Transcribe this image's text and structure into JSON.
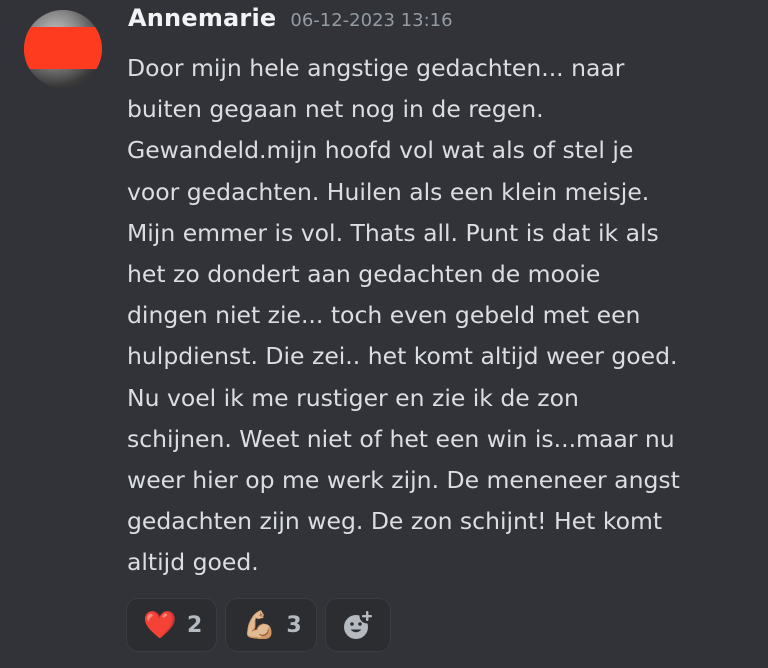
{
  "message": {
    "username": "Annemarie",
    "timestamp": "06-12-2023 13:16",
    "lines": [
      "Door mijn hele angstige gedachten... naar",
      "buiten gegaan net nog in de regen.",
      "Gewandeld.mijn hoofd vol wat als of stel je",
      "voor gedachten. Huilen als een klein meisje.",
      "Mijn emmer is vol. Thats all. Punt is dat ik als",
      "het zo dondert aan gedachten de mooie",
      "dingen niet zie... toch even gebeld met een",
      "hulpdienst. Die zei.. het komt altijd weer goed.",
      "Nu voel ik me rustiger en zie ik de zon",
      "schijnen. Weet niet of het een win is...maar nu",
      "weer hier op me werk zijn. De meneneer angst",
      "gedachten zijn weg. De zon schijnt! Het komt",
      "altijd goed."
    ]
  },
  "reactions": [
    {
      "emoji": "❤️",
      "icon": "red-heart-emoji",
      "count": "2"
    },
    {
      "emoji": "💪🏼",
      "icon": "flexed-biceps-emoji",
      "count": "3"
    }
  ],
  "add_reaction": {
    "icon": "add-reaction-icon"
  },
  "colors": {
    "background": "#313338",
    "username": "#f2f3f5",
    "timestamp": "#949ba4",
    "text": "#dbdee1",
    "reaction_bg": "#2b2d31",
    "avatar_redaction": "#ff3b1f"
  }
}
